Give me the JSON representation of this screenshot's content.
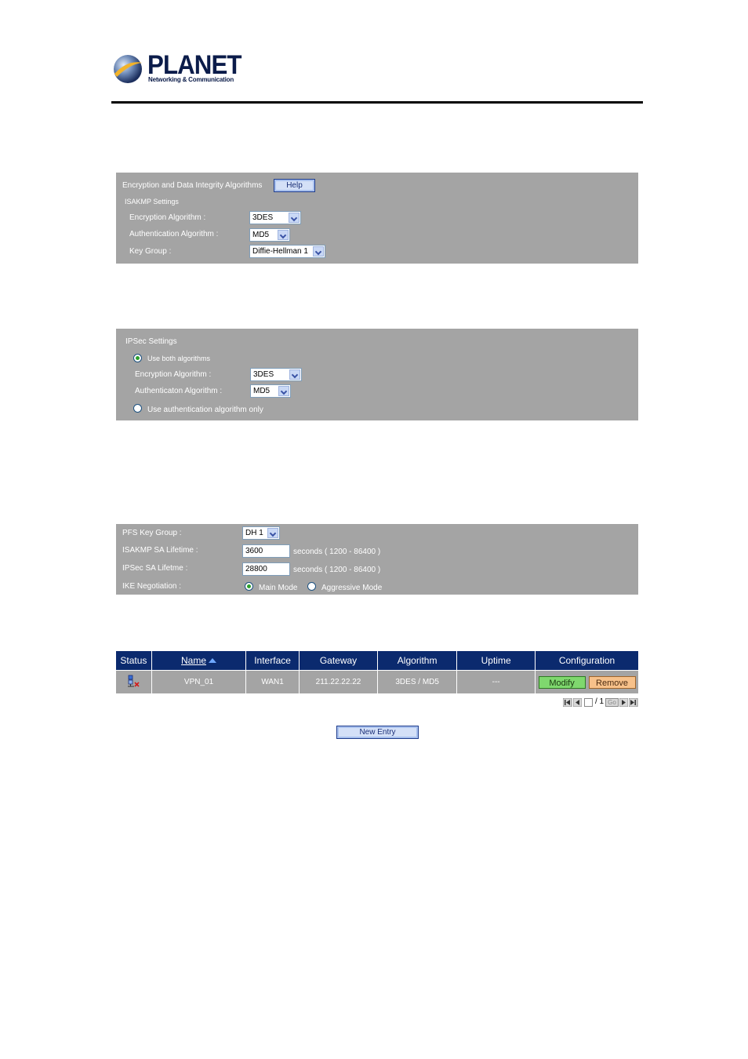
{
  "header": {
    "brand": "PLANET",
    "tagline": "Networking & Communication"
  },
  "isakmp_panel": {
    "title": "Encryption and Data Integrity Algorithms",
    "help_label": "Help",
    "section_label": "ISAKMP Settings",
    "encryption_label": "Encryption Algorithm :",
    "encryption_value": "3DES",
    "authentication_label": "Authentication Algorithm :",
    "authentication_value": "MD5",
    "keygroup_label": "Key Group :",
    "keygroup_value": "Diffie-Hellman 1"
  },
  "ipsec_panel": {
    "section_label": "IPSec Settings",
    "option_both_label": "Use both algorithms",
    "option_both_selected": true,
    "encryption_label": "Encryption Algorithm :",
    "encryption_value": "3DES",
    "authentication_label": "Authenticaton Algorithm :",
    "authentication_value": "MD5",
    "option_auth_only_label": "Use authentication algorithm only",
    "option_auth_only_selected": false
  },
  "pfs_panel": {
    "pfs_label": "PFS Key Group :",
    "pfs_value": "DH 1",
    "isakmp_lifetime_label": "ISAKMP SA Lifetime :",
    "isakmp_lifetime_value": "3600",
    "isakmp_lifetime_hint": "seconds ( 1200 - 86400 )",
    "ipsec_lifetime_label": "IPSec SA Lifetme :",
    "ipsec_lifetime_value": "28800",
    "ipsec_lifetime_hint": "seconds ( 1200 - 86400 )",
    "ike_label": "IKE Negotiation :",
    "ike_main_label": "Main Mode",
    "ike_aggressive_label": "Aggressive Mode",
    "ike_selected": "Main Mode"
  },
  "vpn_table": {
    "columns": [
      "Status",
      "Name",
      "Interface",
      "Gateway",
      "Algorithm",
      "Uptime",
      "Configuration"
    ],
    "rows": [
      {
        "status_icon": "disconnected-tunnel-icon",
        "name": "VPN_01",
        "interface": "WAN1",
        "gateway": "211.22.22.22",
        "algorithm": "3DES / MD5",
        "uptime": "---",
        "modify_label": "Modify",
        "remove_label": "Remove"
      }
    ]
  },
  "pagination": {
    "page_value": "",
    "total_text": "/ 1",
    "go_label": "Go"
  },
  "new_entry_label": "New Entry",
  "colors": {
    "panel_grey": "#a4a4a4",
    "table_header_navy": "#0b2a6e",
    "modify_green": "#7fd86e",
    "remove_orange": "#f7c18a"
  }
}
